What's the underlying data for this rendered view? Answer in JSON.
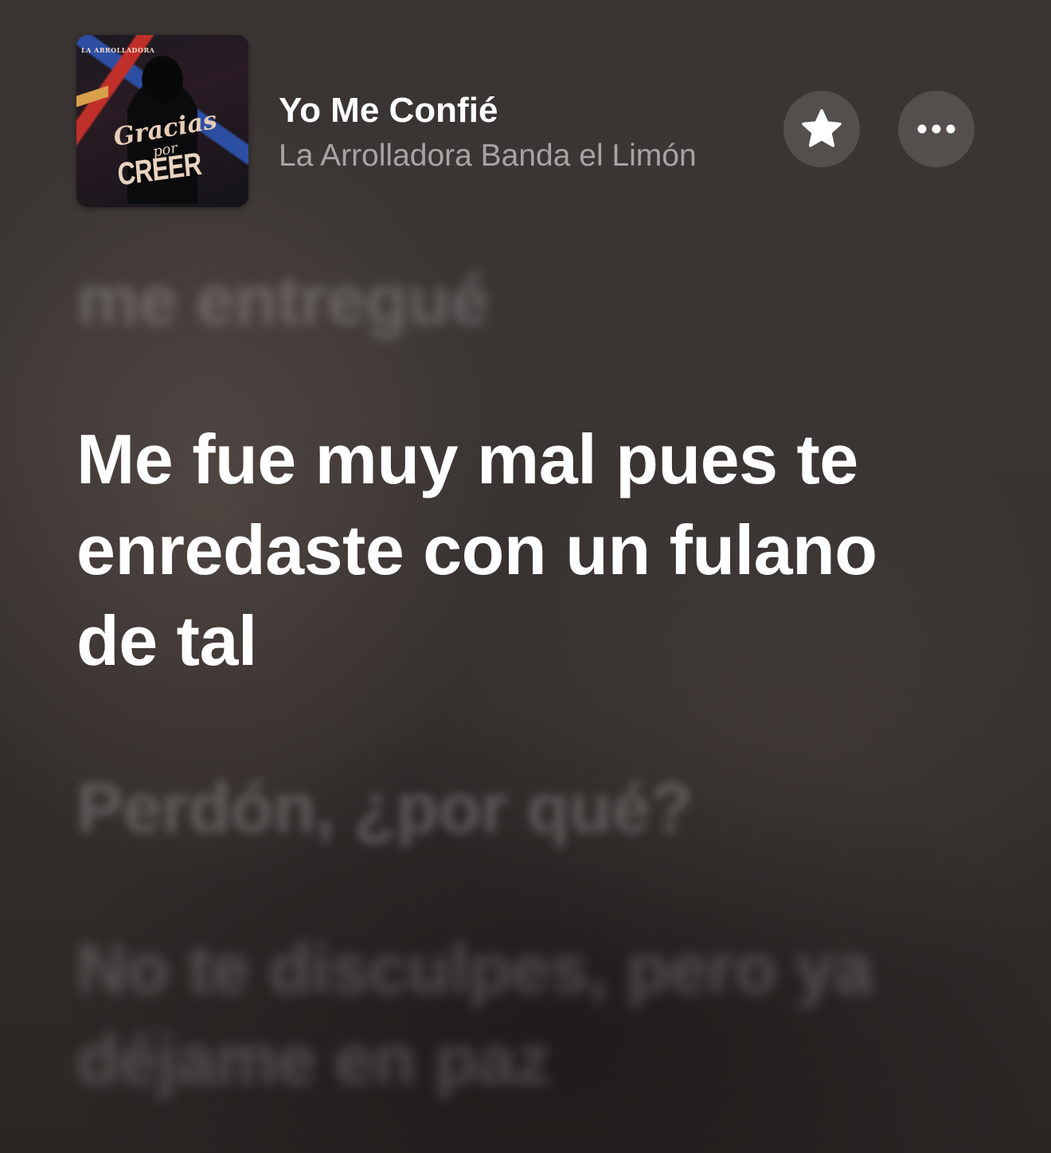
{
  "colors": {
    "background": "#3a3533",
    "active_lyric": "#ffffff",
    "inactive_lyric": "rgba(255,255,255,0.22)",
    "artist_text": "rgba(255,255,255,0.55)",
    "button_bg": "rgba(255,255,255,0.13)"
  },
  "now_playing": {
    "artwork": {
      "label_top": "LA ARROLLADORA",
      "title_line_1": "Gracias",
      "title_line_2": "por",
      "title_line_3": "CREER"
    },
    "title": "Yo Me Confié",
    "artist": "La Arrolladora Banda el Limón",
    "favorite_icon": "star-icon",
    "more_icon": "ellipsis-icon"
  },
  "lyrics": {
    "previous": "me entregué",
    "current": "Me fue muy mal pues te enredaste con un fulano de tal",
    "next": [
      "Perdón, ¿por qué?",
      "No te disculpes, pero ya déjame en paz"
    ]
  }
}
